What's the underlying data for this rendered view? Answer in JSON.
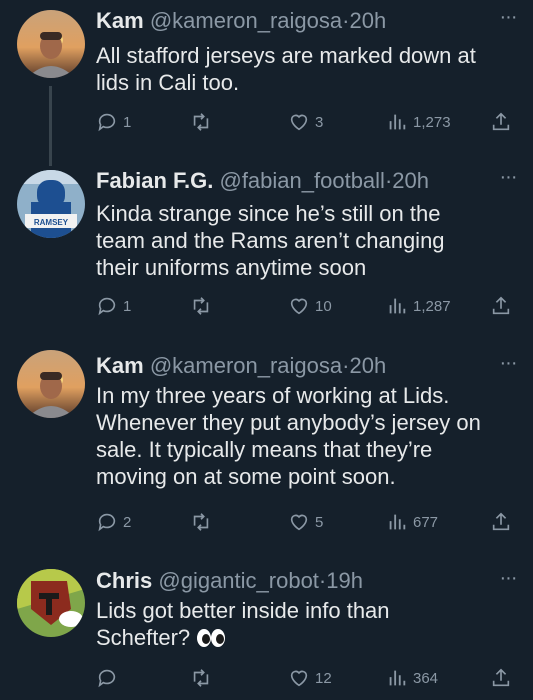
{
  "tweets": [
    {
      "name": "Kam",
      "handle": "@kameron_raigosa",
      "separator": "·",
      "time": "20h",
      "text_lines": [
        "All stafford jerseys are marked down at",
        "lids in Cali too."
      ],
      "replies": "1",
      "retweets": "",
      "likes": "3",
      "views": "1,273"
    },
    {
      "name": "Fabian F.G.",
      "handle": "@fabian_football",
      "separator": "·",
      "time": "20h",
      "avatar_text": "RAMSEY",
      "text_lines": [
        "Kinda strange since he’s still on the",
        "team and the Rams aren’t changing",
        "their uniforms anytime soon"
      ],
      "replies": "1",
      "retweets": "",
      "likes": "10",
      "views": "1,287"
    },
    {
      "name": "Kam",
      "handle": "@kameron_raigosa",
      "separator": "·",
      "time": "20h",
      "text_lines": [
        "In my three years of working at Lids.",
        "Whenever they put anybody’s jersey on",
        "sale. It typically means that they’re",
        "moving on at some point soon."
      ],
      "replies": "2",
      "retweets": "",
      "likes": "5",
      "views": "677"
    },
    {
      "name": "Chris",
      "handle": "@gigantic_robot",
      "separator": "·",
      "time": "19h",
      "text_lines": [
        "Lids got better inside info than",
        "Schefter? "
      ],
      "emoji": "eyes-emoji",
      "replies": "",
      "retweets": "",
      "likes": "12",
      "views": "364"
    }
  ],
  "icons": {
    "reply": "reply-icon",
    "retweet": "retweet-icon",
    "like": "heart-icon",
    "views": "views-chart-icon",
    "share": "share-icon",
    "more": "more-icon"
  },
  "colors": {
    "background": "#15202b",
    "text": "#e7e9ea",
    "muted": "#8b98a5",
    "connector": "#38444d"
  }
}
